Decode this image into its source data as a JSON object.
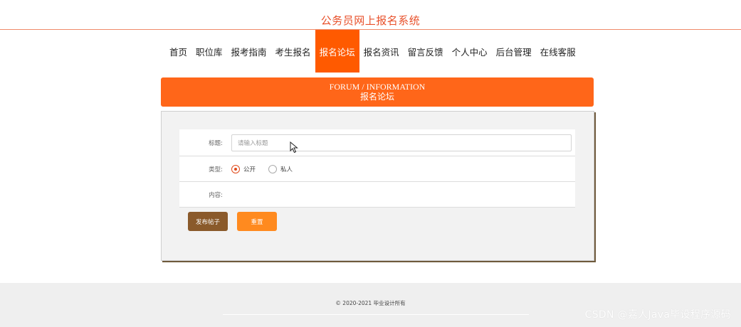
{
  "header": {
    "site_title": "公务员网上报名系统"
  },
  "nav": {
    "items": [
      {
        "label": "首页"
      },
      {
        "label": "职位库"
      },
      {
        "label": "报考指南"
      },
      {
        "label": "考生报名"
      },
      {
        "label": "报名论坛",
        "active": true
      },
      {
        "label": "报名资讯"
      },
      {
        "label": "留言反馈"
      },
      {
        "label": "个人中心"
      },
      {
        "label": "后台管理"
      },
      {
        "label": "在线客服"
      }
    ]
  },
  "panel": {
    "title_en": "FORUM / INFORMATION",
    "title_zh": "报名论坛"
  },
  "form": {
    "title_label": "标题:",
    "title_placeholder": "请输入标题",
    "title_value": "",
    "type_label": "类型:",
    "type_options": [
      {
        "label": "公开",
        "checked": true
      },
      {
        "label": "私人",
        "checked": false
      }
    ],
    "content_label": "内容:",
    "publish_button": "发布帖子",
    "reset_button": "重置"
  },
  "footer": {
    "copyright": "© 2020-2021 毕业设计所有"
  },
  "watermark": "CSDN @嘉人Java毕设程序源码",
  "colors": {
    "accent": "#ff5a00",
    "panel_head": "#ff6619",
    "publish": "#8a5a2b",
    "reset": "#ff8a1f"
  }
}
